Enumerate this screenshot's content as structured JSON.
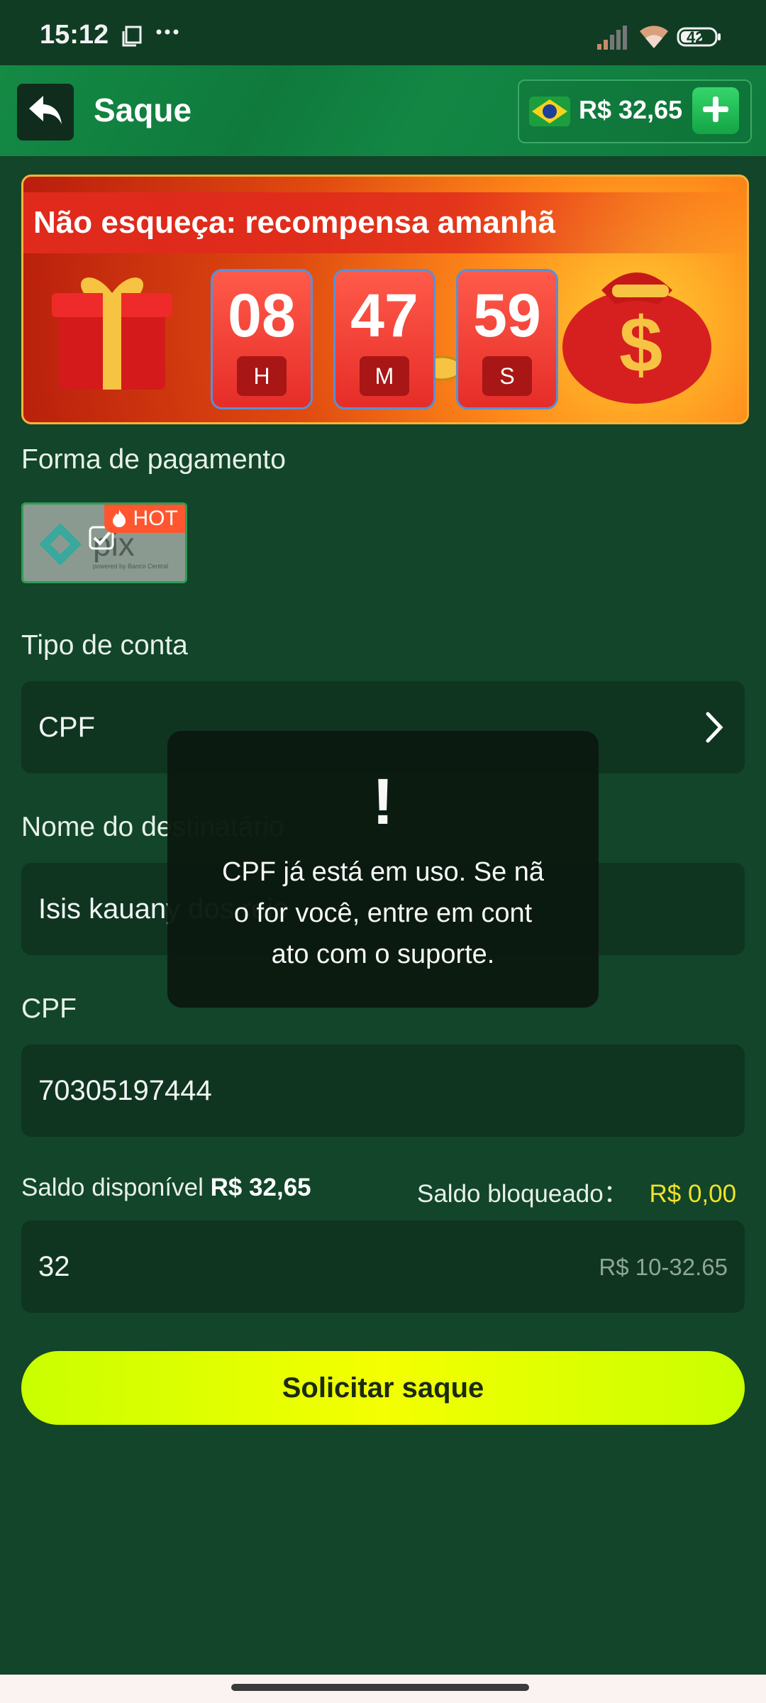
{
  "status_bar": {
    "time": "15:12",
    "battery": "42"
  },
  "header": {
    "title": "Saque",
    "balance": "R$ 32,65"
  },
  "banner": {
    "text": "Não esqueça: recompensa amanhã",
    "hours": "08",
    "minutes": "47",
    "seconds": "59",
    "hours_unit": "H",
    "minutes_unit": "M",
    "seconds_unit": "S"
  },
  "payment": {
    "label": "Forma de pagamento",
    "method": "pix",
    "badge": "HOT"
  },
  "account_type": {
    "label": "Tipo de conta",
    "value": "CPF"
  },
  "recipient": {
    "label": "Nome do destinatário",
    "value": "Isis kauany dos reis"
  },
  "cpf": {
    "label": "CPF",
    "value": "70305197444"
  },
  "balance_info": {
    "available_label": "Saldo disponível",
    "available_value": "R$ 32,65",
    "blocked_label": "Saldo bloqueado：",
    "blocked_value": "R$ 0,00"
  },
  "amount": {
    "value": "32",
    "range_hint": "R$ 10-32.65"
  },
  "submit_label": "Solicitar saque",
  "toast": {
    "icon": "!",
    "line1": "CPF já está em uso. Se nã",
    "line2": "o for você, entre em cont",
    "line3": "ato com o suporte."
  },
  "colors": {
    "accent_button": "#d8ff00",
    "header_green": "#138644",
    "blocked_value": "#f0e326"
  }
}
